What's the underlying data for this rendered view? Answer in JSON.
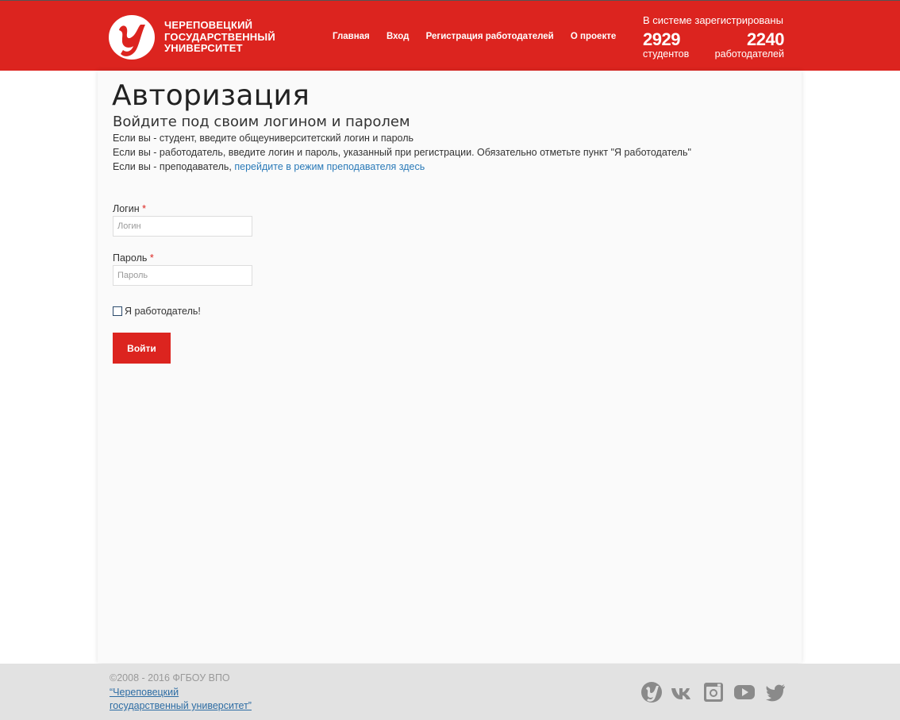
{
  "header": {
    "logo_lines": [
      "ЧЕРЕПОВЕЦКИЙ",
      "ГОСУДАРСТВЕННЫЙ",
      "УНИВЕРСИТЕТ"
    ],
    "nav": [
      "Главная",
      "Вход",
      "Регистрация работодателей",
      "О проекте"
    ],
    "stats_title": "В системе зарегистрированы",
    "students_count": "2929",
    "students_label": "студентов",
    "employers_count": "2240",
    "employers_label": "работодателей",
    "accent_color": "#dc241f"
  },
  "main": {
    "title": "Авторизация",
    "subtitle": "Войдите под своим логином и паролем",
    "info_student": "Если вы - студент, введите общеуниверситетский логин и пароль",
    "info_employer": "Если вы - работодатель, введите логин и пароль, указанный при регистрации. Обязательно отметьте пункт \"Я работодатель\"",
    "info_teacher_prefix": "Если вы - преподаватель, ",
    "info_teacher_link": "перейдите в режим преподавателя здесь",
    "login_label": "Логин",
    "login_placeholder": "Логин",
    "password_label": "Пароль",
    "password_placeholder": "Пароль",
    "required_mark": "*",
    "employer_checkbox": "Я работодатель!",
    "submit": "Войти"
  },
  "footer": {
    "copyright": "©2008 - 2016 ФГБОУ ВПО",
    "link_line1": "“Череповецкий",
    "link_line2": "государственный университет”",
    "social_icons": [
      "chsu-icon",
      "vk-icon",
      "instagram-icon",
      "youtube-icon",
      "twitter-icon"
    ]
  }
}
